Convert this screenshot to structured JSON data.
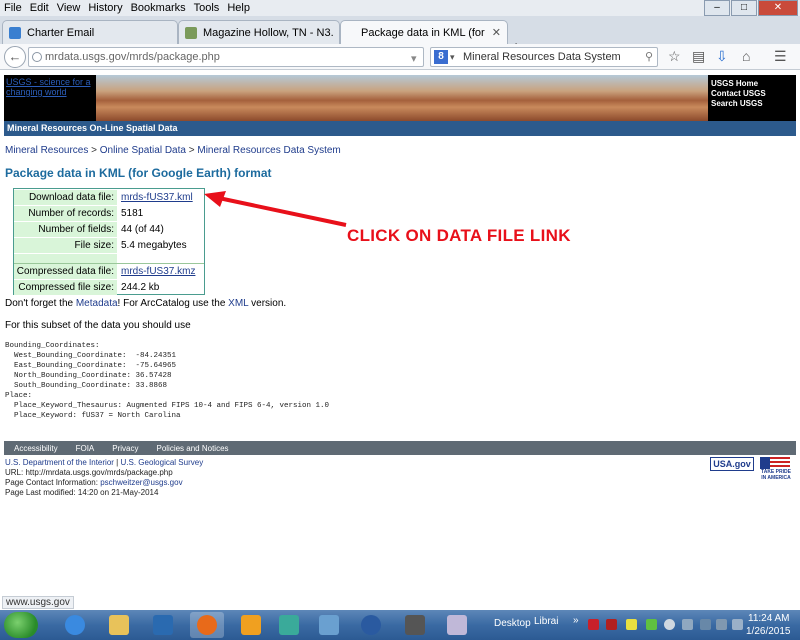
{
  "menu": [
    "File",
    "Edit",
    "View",
    "History",
    "Bookmarks",
    "Tools",
    "Help"
  ],
  "tabs": [
    {
      "label": "Charter Email",
      "active": false
    },
    {
      "label": "Magazine Hollow, TN - N3...",
      "active": false
    },
    {
      "label": "Package data in KML (for ...",
      "active": true
    }
  ],
  "url": "mrdata.usgs.gov/mrds/package.php",
  "search_text": "Mineral Resources Data System",
  "banner": {
    "left_link": "USGS - science for a changing world",
    "right_links": [
      "USGS Home",
      "Contact USGS",
      "Search USGS"
    ]
  },
  "site_bar": "Mineral Resources On-Line Spatial Data",
  "breadcrumb": {
    "items": [
      "Mineral Resources",
      "Online Spatial Data",
      "Mineral Resources Data System"
    ],
    "separator": ">"
  },
  "page_title": "Package data in KML (for Google Earth) format",
  "data_table": {
    "download_label": "Download data file:",
    "download_value": "mrds-fUS37.kml",
    "records_label": "Number of records:",
    "records_value": "5181",
    "fields_label": "Number of fields:",
    "fields_value": "44 (of 44)",
    "size_label": "File size:",
    "size_value": "5.4 megabytes",
    "compressed_label": "Compressed data file:",
    "compressed_value": "mrds-fUS37.kmz",
    "compressed_size_label": "Compressed file size:",
    "compressed_size_value": "244.2 kb"
  },
  "callout": "CLICK ON DATA FILE LINK",
  "metadata_line": {
    "pre": "Don't forget the",
    "link1": "Metadata",
    "mid": "! For ArcCatalog use the",
    "link2": "XML",
    "post": "version."
  },
  "subset_line": "For this subset of the data you should use",
  "pre_block": "Bounding_Coordinates:\n  West_Bounding_Coordinate:  -84.24351\n  East_Bounding_Coordinate:  -75.64965\n  North_Bounding_Coordinate: 36.57428\n  South_Bounding_Coordinate: 33.8868\nPlace:\n  Place_Keyword_Thesaurus: Augmented FIPS 10-4 and FIPS 6-4, version 1.0\n  Place_Keyword: fUS37 = North Carolina",
  "footer_links": [
    "Accessibility",
    "FOIA",
    "Privacy",
    "Policies and Notices"
  ],
  "footer_info": {
    "doi": "U.S. Department of the Interior",
    "sep": "|",
    "usgs": "U.S. Geological Survey",
    "url_label": "URL:",
    "url_value": "http://mrdata.usgs.gov/mrds/package.php",
    "contact_label": "Page Contact Information:",
    "contact_value": "pschweitzer@usgs.gov",
    "modified": "Page Last modified: 14:20 on 21-May-2014"
  },
  "usagov": "USA.gov",
  "take_pride": "TAKE PRIDE IN AMERICA",
  "status_url": "www.usgs.gov",
  "taskbar": {
    "desktop_label": "Desktop",
    "library_label": "Librai",
    "chevron": "»",
    "time": "11:24 AM",
    "date": "1/26/2015"
  },
  "colors": {
    "title_blue": "#1d6b9e",
    "link_blue": "#1f3c8c",
    "callout_red": "#e8101a",
    "table_label_bg": "#d9f5d9",
    "site_bar": "#2c5a8c"
  }
}
